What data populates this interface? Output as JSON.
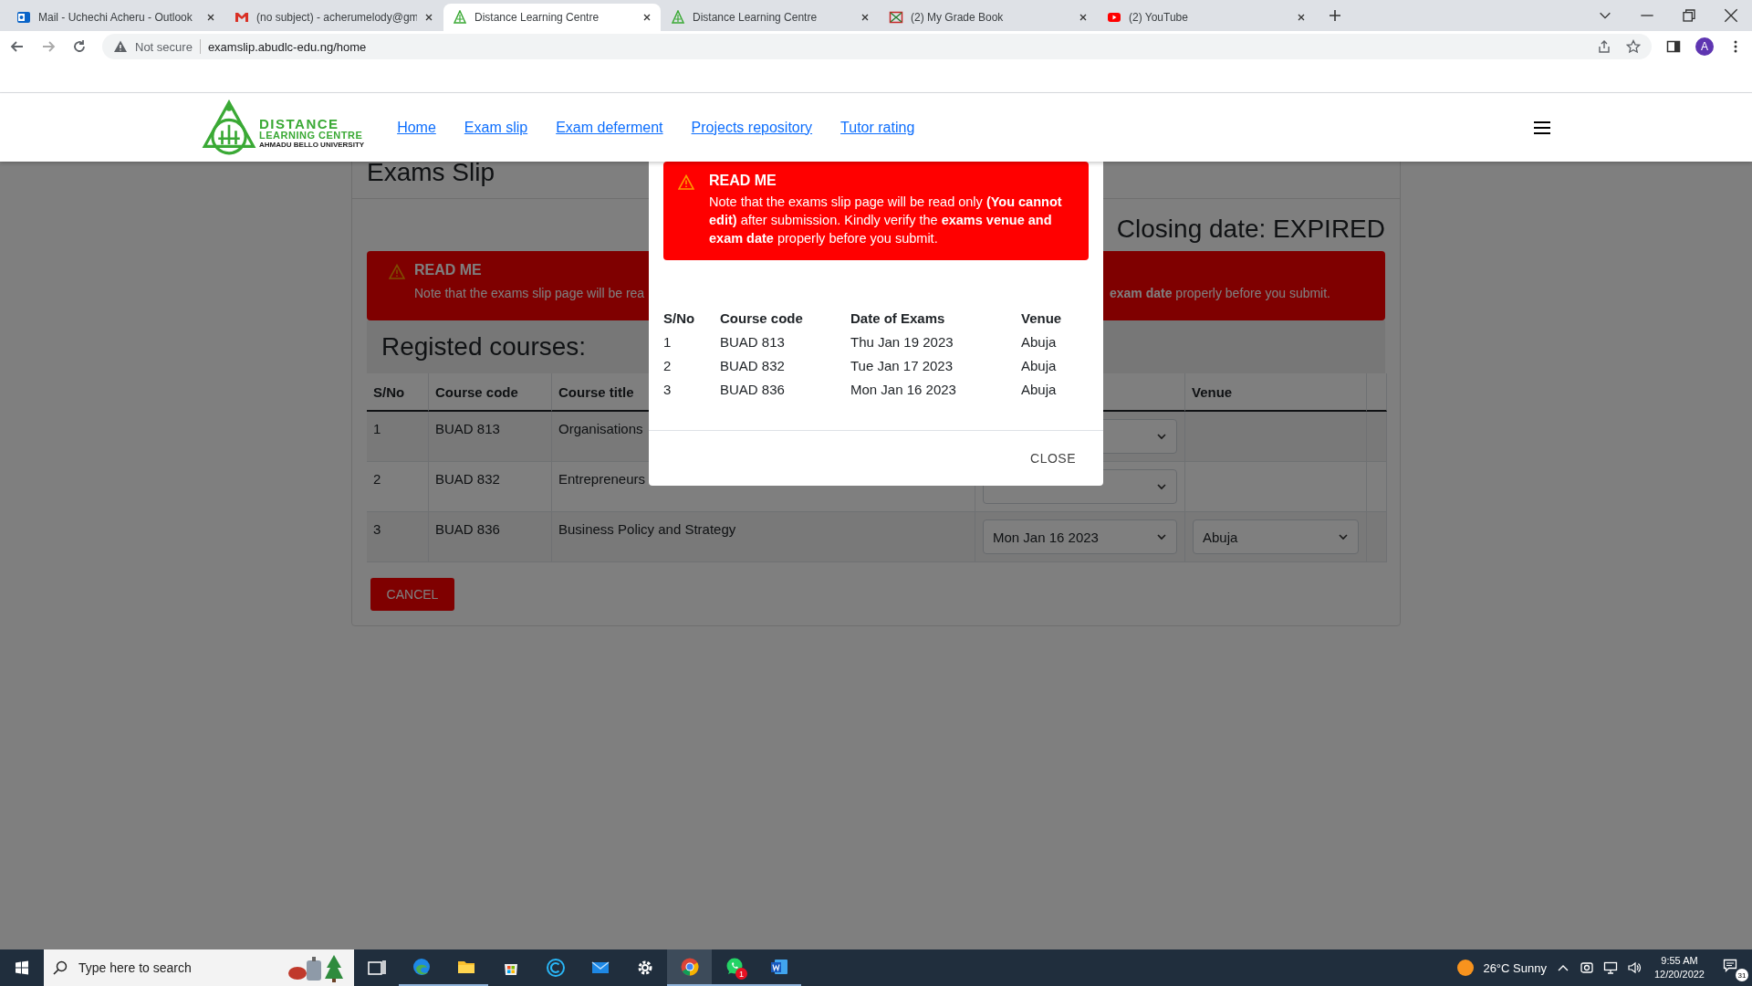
{
  "browser": {
    "tabs": [
      {
        "title": "Mail - Uchechi Acheru - Outlook",
        "kind": "outlook",
        "selected": false
      },
      {
        "title": "(no subject) - acherumelody@gm",
        "kind": "gmail",
        "selected": false
      },
      {
        "title": "Distance Learning Centre",
        "kind": "emblem",
        "selected": true
      },
      {
        "title": "Distance Learning Centre",
        "kind": "emblem",
        "selected": false
      },
      {
        "title": "(2) My Grade Book",
        "kind": "gradebook",
        "selected": false
      },
      {
        "title": "(2) YouTube",
        "kind": "youtube",
        "selected": false
      }
    ],
    "address": {
      "security": "Not secure",
      "url": "examslip.abudlc-edu.ng/home"
    },
    "profile_initial": "A"
  },
  "site_header": {
    "logo": {
      "line_1": "DISTANCE",
      "line_2": "LEARNING CENTRE",
      "line_3": "AHMADU BELLO UNIVERSITY"
    },
    "nav": [
      "Home",
      "Exam slip",
      "Exam deferment",
      "Projects repository",
      "Tutor rating"
    ]
  },
  "page": {
    "title": "Exams Slip",
    "closing_date": "Closing date: EXPIRED",
    "alert": {
      "heading": "READ ME",
      "text_start": "Note that the exams slip page will be rea",
      "text_end": "**exam date** properly before you submit."
    },
    "section_title": "Registed courses:",
    "table": {
      "columns": [
        "S/No",
        "Course code",
        "Course title",
        "Venue"
      ],
      "rows": [
        {
          "sno": "1",
          "code": "BUAD 813",
          "title": "Organisations",
          "venue_select": false
        },
        {
          "sno": "2",
          "code": "BUAD 832",
          "title": "Entrepreneurs",
          "venue_select": false
        },
        {
          "sno": "3",
          "code": "BUAD 836",
          "title": "Business Policy and Strategy",
          "date": "Mon Jan 16 2023",
          "venue_select": true,
          "venue": "Abuja"
        }
      ]
    },
    "cancel_label": "CANCEL"
  },
  "modal": {
    "alert": {
      "heading": "READ ME",
      "text": "Note that the exams slip page will be read only **(You cannot edit)** after submission. Kindly verify the **exams venue and exam date** properly before you submit."
    },
    "table": {
      "columns": [
        "S/No",
        "Course code",
        "Date of Exams",
        "Venue"
      ],
      "rows": [
        [
          "1",
          "BUAD 813",
          "Thu Jan 19 2023",
          "Abuja"
        ],
        [
          "2",
          "BUAD 832",
          "Tue Jan 17 2023",
          "Abuja"
        ],
        [
          "3",
          "BUAD 836",
          "Mon Jan 16 2023",
          "Abuja"
        ]
      ]
    },
    "close_label": "CLOSE"
  },
  "taskbar": {
    "search_placeholder": "Type here to search",
    "apps": [
      {
        "kind": "task-view",
        "open": false,
        "selected": false
      },
      {
        "kind": "edge",
        "open": true,
        "selected": false
      },
      {
        "kind": "folder",
        "open": true,
        "selected": false
      },
      {
        "kind": "store",
        "open": false,
        "selected": false
      },
      {
        "kind": "cleaner",
        "open": false,
        "selected": false
      },
      {
        "kind": "mail",
        "open": false,
        "selected": false
      },
      {
        "kind": "settings",
        "open": false,
        "selected": false
      },
      {
        "kind": "chrome",
        "open": true,
        "selected": true
      },
      {
        "kind": "chat",
        "open": true,
        "selected": false,
        "badge": "1"
      },
      {
        "kind": "word",
        "open": true,
        "selected": false
      }
    ],
    "weather": "26°C  Sunny",
    "time": "9:55 AM",
    "date": "12/20/2022",
    "notifications": "31"
  }
}
